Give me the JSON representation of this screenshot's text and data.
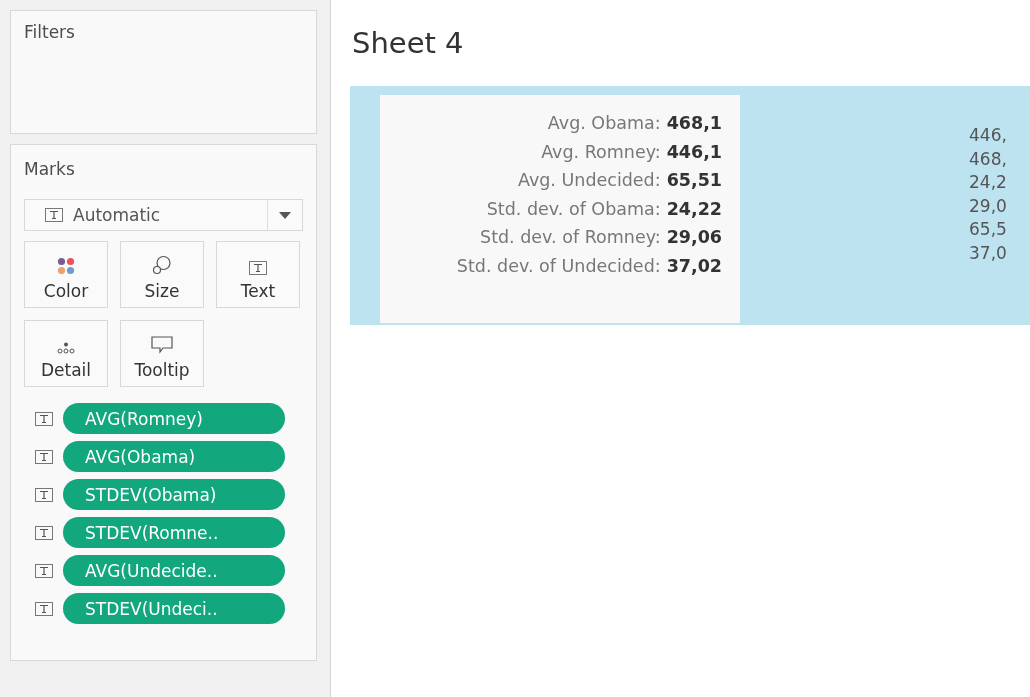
{
  "filters": {
    "title": "Filters"
  },
  "marks": {
    "title": "Marks",
    "mark_type": "Automatic",
    "cards": [
      {
        "kind": "color",
        "label": "Color"
      },
      {
        "kind": "size",
        "label": "Size"
      },
      {
        "kind": "text",
        "label": "Text"
      },
      {
        "kind": "detail",
        "label": "Detail"
      },
      {
        "kind": "tooltip",
        "label": "Tooltip"
      }
    ],
    "fields": [
      {
        "label": "AVG(Romney)"
      },
      {
        "label": "AVG(Obama)"
      },
      {
        "label": "STDEV(Obama)"
      },
      {
        "label": "STDEV(Romne.."
      },
      {
        "label": "AVG(Undecide.."
      },
      {
        "label": "STDEV(Undeci.."
      }
    ]
  },
  "sheet": {
    "title": "Sheet 4",
    "tooltip": [
      {
        "label": "Avg. Obama:",
        "value": "468,1"
      },
      {
        "label": "Avg. Romney:",
        "value": "446,1"
      },
      {
        "label": "Avg. Undecided:",
        "value": "65,51"
      },
      {
        "label": "Std. dev. of Obama:",
        "value": "24,22"
      },
      {
        "label": "Std. dev. of Romney:",
        "value": "29,06"
      },
      {
        "label": "Std. dev. of Undecided:",
        "value": "37,02"
      }
    ],
    "values": [
      "446,",
      "468,",
      "24,2",
      "29,0",
      "65,5",
      "37,0"
    ]
  }
}
